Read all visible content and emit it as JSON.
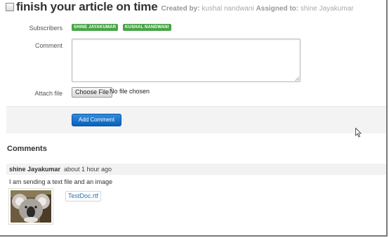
{
  "task": {
    "title": "finish your article on time",
    "created_by_label": "Created by:",
    "created_by": "kushal nandwani",
    "assigned_to_label": "Assigned to:",
    "assigned_to": "shine Jayakumar"
  },
  "form": {
    "subscribers_label": "Subscribers",
    "subscribers": [
      "SHINE JAYAKUMAR",
      "KUSHAL NANDWANI"
    ],
    "comment_label": "Comment",
    "comment_value": "",
    "attach_label": "Attach file",
    "choose_file_label": "Choose File",
    "no_file_text": "No file chosen",
    "add_comment_label": "Add Comment"
  },
  "comments": {
    "heading": "Comments",
    "items": [
      {
        "author": "shine Jayakumar",
        "time": "about 1 hour ago",
        "text": "I am sending a text file and an image",
        "attachment": "TestDoc.rtf"
      }
    ]
  },
  "colors": {
    "tag_green": "#46a546",
    "button_blue": "#0b5fb8",
    "link_blue": "#2a6fb0"
  }
}
